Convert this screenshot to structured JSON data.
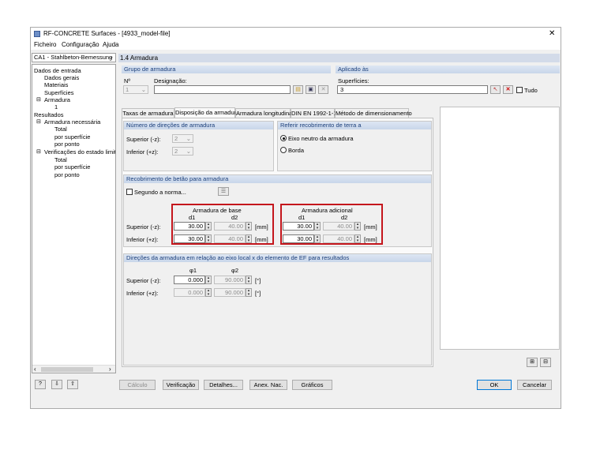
{
  "window": {
    "title": "RF-CONCRETE Surfaces - [4933_model-file]",
    "close": "✕"
  },
  "menu": [
    "Ficheiro",
    "Configuração",
    "Ajuda"
  ],
  "case_combo": "CA1 - Stahlbeton-Bemessung",
  "tree": {
    "input_data": "Dados de entrada",
    "general": "Dados gerais",
    "materials": "Materiais",
    "surfaces": "Superfícies",
    "reinforcement": "Armadura",
    "reinforcement_1": "1",
    "results": "Resultados",
    "required": "Armadura necessária",
    "total1": "Total",
    "per_surface1": "por superfície",
    "per_point1": "por ponto",
    "sls": "Verificações do estado limite de",
    "total2": "Total",
    "per_surface2": "por superfície",
    "per_point2": "por ponto"
  },
  "section_title": "1.4 Armadura",
  "group": {
    "title": "Grupo de armadura",
    "no_label": "Nº",
    "no_value": "1",
    "name_label": "Designação:",
    "name_value": ""
  },
  "applied": {
    "title": "Aplicado às",
    "surfaces_label": "Superfícies:",
    "surfaces_value": "3",
    "all_label": "Tudo"
  },
  "tabs": [
    "Taxas de armadura",
    "Disposição da armadura",
    "Armadura longitudinal",
    "DIN EN 1992-1-1",
    "Método de dimensionamento"
  ],
  "directions": {
    "title": "Número de direções de armadura",
    "top_label": "Superior (-z):",
    "top_value": "2",
    "bottom_label": "Inferior (+z):",
    "bottom_value": "2"
  },
  "cover_ref": {
    "title": "Referir recobrimento de terra a",
    "opt1": "Eixo neutro da armadura",
    "opt2": "Borda"
  },
  "cover": {
    "title": "Recobrimento de betão para armadura",
    "norm_label": "Segundo a norma...",
    "base_title": "Armadura de base",
    "add_title": "Armadura adicional",
    "d1": "d1",
    "d2": "d2",
    "top_label": "Superior (-z):",
    "bottom_label": "Inferior (+z):",
    "unit": "[mm]",
    "base_top_d1": "30.00",
    "base_top_d2": "40.00",
    "base_bot_d1": "30.00",
    "base_bot_d2": "40.00",
    "add_top_d1": "30.00",
    "add_top_d2": "40.00",
    "add_bot_d1": "30.00",
    "add_bot_d2": "40.00"
  },
  "angles": {
    "title": "Direções da armadura em relação ao eixo local x do elemento de EF para resultados",
    "phi1": "φ1",
    "phi2": "φ2",
    "top_label": "Superior (-z):",
    "bottom_label": "Inferior (+z):",
    "unit": "[°]",
    "top_phi1": "0.000",
    "top_phi2": "90.000",
    "bot_phi1": "0.000",
    "bot_phi2": "90.000"
  },
  "buttons": {
    "calc": "Cálculo",
    "check": "Verificação",
    "details": "Detalhes...",
    "annex": "Anex. Nac.",
    "graphics": "Gráficos",
    "ok": "OK",
    "cancel": "Cancelar"
  }
}
